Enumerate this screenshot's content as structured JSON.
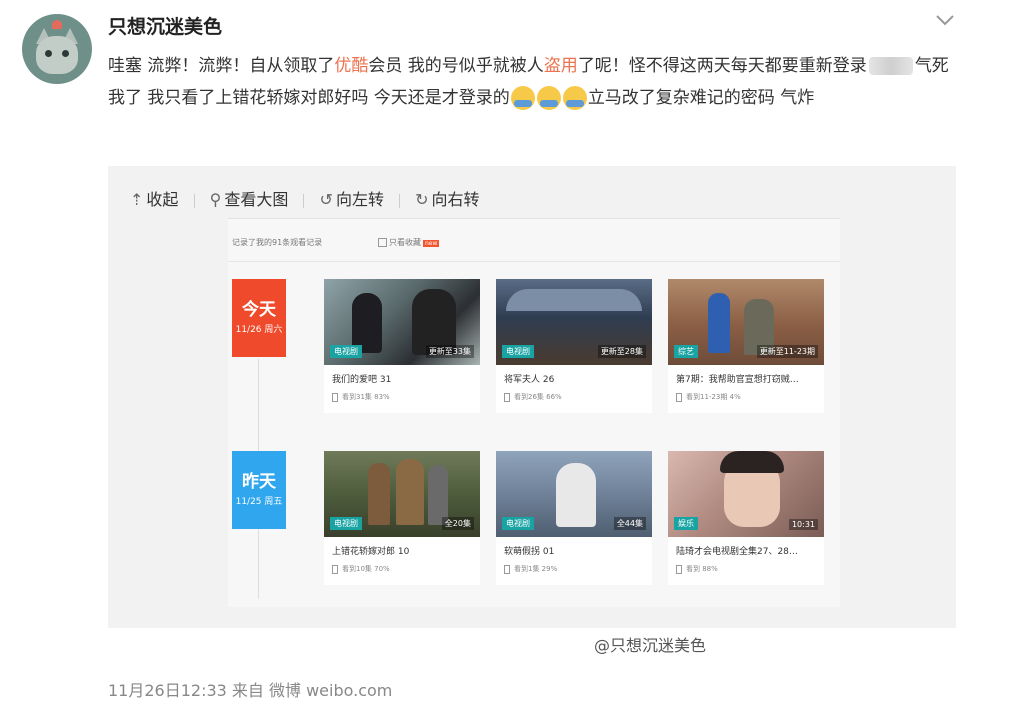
{
  "post": {
    "username": "只想沉迷美色",
    "text": {
      "p1": "哇塞 流弊！流弊！自从领取了",
      "brand": "优酷",
      "p2": "会员 我的号似乎就被人",
      "stolen": "盗用",
      "p3": "了呢！怪不得这两天每天都要重新登录",
      "p4": "气死我了 我只看了上错花轿嫁对郎好吗 今天还是才登录的",
      "p5": "立马改了复杂难记的密码 气炸"
    },
    "emoji_count": 3,
    "footer": "11月26日12:33 来自 微博 weibo.com"
  },
  "media_toolbar": {
    "collapse": "收起",
    "view_large": "查看大图",
    "rotate_left": "向左转",
    "rotate_right": "向右转"
  },
  "history": {
    "header": "记录了我的91条观看记录",
    "only_favorites": "只看收藏",
    "new_badge": "new",
    "days": [
      {
        "title": "今天",
        "date": "11/26 周六",
        "color": "#ee4a2b"
      },
      {
        "title": "昨天",
        "date": "11/25 周五",
        "color": "#2fa6ee"
      }
    ],
    "cards": [
      {
        "title": "我们的爱吧 31",
        "tag": "电视剧",
        "episode": "更新至33集",
        "progress": "看到31集 83%"
      },
      {
        "title": "将军夫人 26",
        "tag": "电视剧",
        "episode": "更新至28集",
        "progress": "看到26集 66%"
      },
      {
        "title": "第7期：我帮助官宣想打窃贼…",
        "tag": "综艺",
        "episode": "更新至11-23期",
        "progress": "看到11-23期 4%"
      },
      {
        "title": "上错花轿嫁对郎 10",
        "tag": "电视剧",
        "episode": "全20集",
        "progress": "看到10集 70%"
      },
      {
        "title": "软萌假拐 01",
        "tag": "电视剧",
        "episode": "全44集",
        "progress": "看到1集 29%"
      },
      {
        "title": "陆琦才会电视剧全集27、28…",
        "tag": "娱乐",
        "episode": "10:31",
        "progress": "看到 88%"
      }
    ],
    "watermark": "@只想沉迷美色"
  },
  "colors": {
    "today": "#ee4a2b",
    "yesterday": "#2fa6ee",
    "highlight": "#eb7350",
    "tag": "#1aa3a3"
  }
}
